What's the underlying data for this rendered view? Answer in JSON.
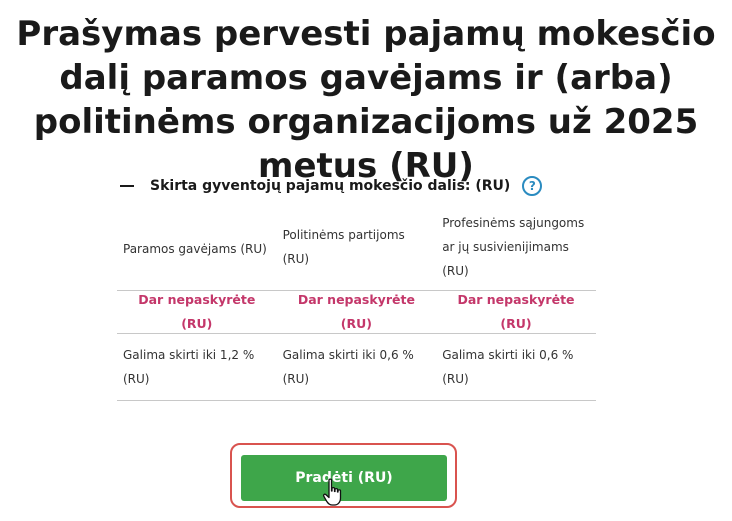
{
  "title": "Prašymas pervesti pajamų mokesčio dalį paramos gavėjams ir (arba) politinėms organizacijoms už 2025 metus (RU)",
  "section": {
    "heading": "Skirta gyventojų pajamų mokesčio dalis: (RU)",
    "help_icon": "?"
  },
  "columns": [
    {
      "header": "Paramos gavėjams (RU)",
      "status_link": "Dar nepaskyrėte (RU)",
      "amount": "Galima skirti iki 1,2 % (RU)"
    },
    {
      "header": "Politinėms partijoms (RU)",
      "status_link": "Dar nepaskyrėte (RU)",
      "amount": "Galima skirti iki 0,6 % (RU)"
    },
    {
      "header": "Profesinėms sąjungoms ar jų susivienijimams (RU)",
      "status_link": "Dar nepaskyrėte (RU)",
      "amount": "Galima skirti iki 0,6 % (RU)"
    }
  ],
  "start_button": {
    "label": "Pradėti (RU)"
  },
  "colors": {
    "accent_green": "#3ea64a",
    "link_pink": "#c4376a",
    "help_blue": "#2a8bc0",
    "highlight_red": "#d9534f"
  }
}
